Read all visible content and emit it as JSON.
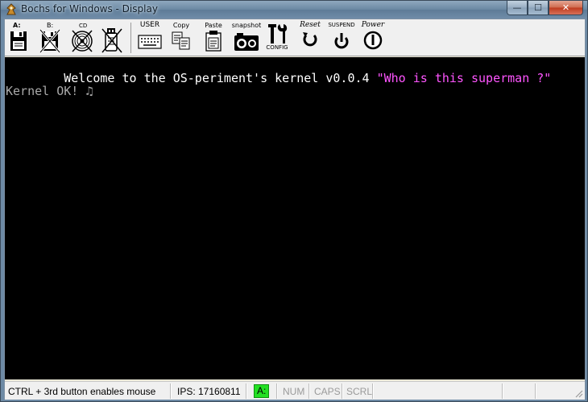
{
  "window": {
    "title": "Bochs for Windows - Display",
    "controls": {
      "minimize": "—",
      "maximize": "☐",
      "close": "✕"
    }
  },
  "toolbar": {
    "floppy_a": "A:",
    "floppy_b": "B:",
    "cdrom": "CD",
    "user": "USER",
    "copy": "Copy",
    "paste": "Paste",
    "snapshot": "snapshot",
    "config": "CONFIG",
    "reset": "Reset",
    "suspend": "SUSPEND",
    "power": "Power"
  },
  "screen": {
    "line1_white": "Welcome to the OS-periment's kernel v0.0.4 ",
    "line1_magenta": "\"Who is this superman ?\"",
    "line2": "Kernel OK! ♫",
    "colors": {
      "background": "#000000",
      "white": "#ffffff",
      "gray": "#aaaaaa",
      "magenta": "#ff55ff"
    }
  },
  "statusbar": {
    "mouse_hint": "CTRL + 3rd button enables mouse",
    "ips": "IPS:  17160811",
    "drive_led": "A:",
    "num": "NUM",
    "caps": "CAPS",
    "scrl": "SCRL",
    "led_color": "#22e022"
  }
}
